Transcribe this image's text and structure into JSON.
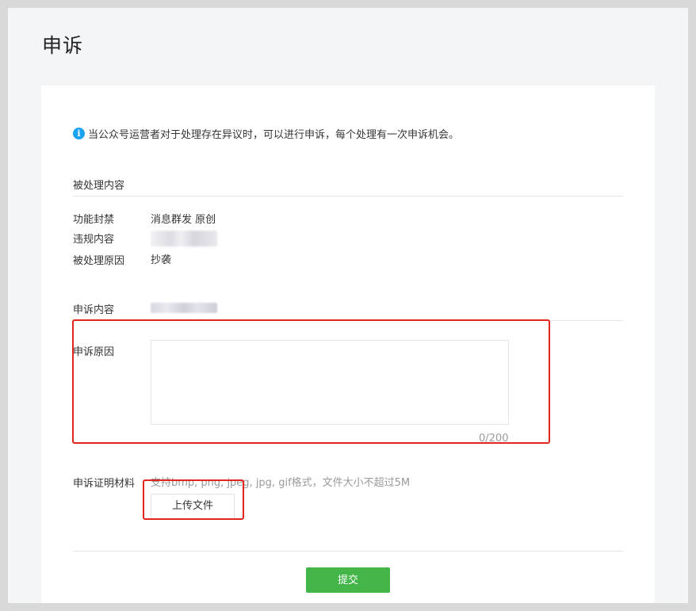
{
  "page": {
    "title": "申诉"
  },
  "notice": {
    "icon": "info-icon",
    "text": "当公众号运营者对于处理存在异议时，可以进行申诉，每个处理有一次申诉机会。"
  },
  "handled_content": {
    "section_title": "被处理内容",
    "rows": [
      {
        "label": "功能封禁",
        "value": "消息群发 原创"
      },
      {
        "label": "违规内容",
        "value": ""
      },
      {
        "label": "被处理原因",
        "value": "抄袭"
      }
    ]
  },
  "appeal": {
    "section_title": "申诉内容",
    "reason_label": "申诉原因",
    "reason_value": "",
    "reason_counter": "0/200",
    "proof_label": "申诉证明材料",
    "proof_hint": "支持bmp, png, jpeg, jpg, gif格式，文件大小不超过5M",
    "upload_label": "上传文件"
  },
  "actions": {
    "submit_label": "提交"
  },
  "colors": {
    "primary_green": "#44b549",
    "info_blue": "#1aa3f0",
    "highlight_red": "#e1251b"
  }
}
